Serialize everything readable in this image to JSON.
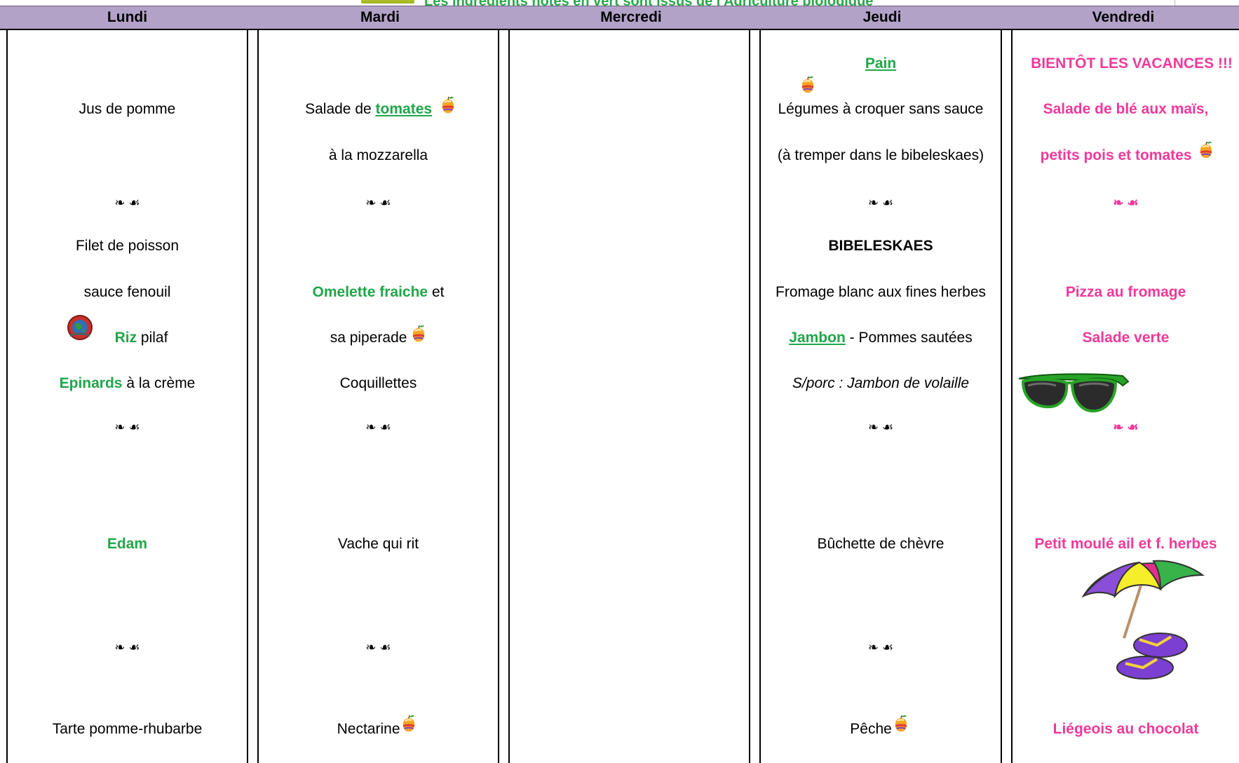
{
  "banner": {
    "text": "Les ingrédients notés en vert sont issus de l'Agriculture biologique"
  },
  "days": [
    "Lundi",
    "Mardi",
    "Mercredi",
    "Jeudi",
    "Vendredi"
  ],
  "separator": "❧ ☙",
  "lundi": {
    "entree": "Jus de pomme",
    "plat_1": "Filet de poisson",
    "plat_2": "sauce fenouil",
    "riz_bio": "Riz",
    "riz_rest": "pilaf",
    "epinards_bio": "Epinards",
    "epinards_rest": "à la crème",
    "fromage": "Edam",
    "dessert": "Tarte pomme-rhubarbe"
  },
  "mardi": {
    "entree_1a": "Salade de",
    "entree_1b": "tomates",
    "entree_2": "à la mozzarella",
    "plat_1a": "Omelette fraiche",
    "plat_1b": "et",
    "plat_2": "sa piperade",
    "plat_3": "Coquillettes",
    "fromage": "Vache qui rit",
    "dessert": "Nectarine"
  },
  "jeudi": {
    "pain": "Pain",
    "entree_1": "Légumes à croquer sans sauce",
    "entree_2": "(à tremper dans le bibeleskaes)",
    "plat_title": "BIBELESKAES",
    "plat_1": "Fromage blanc aux fines herbes",
    "jambon": "Jambon",
    "plat_2_rest": "- Pommes sautées",
    "plat_3": "S/porc : Jambon de volaille",
    "fromage": "Bûchette de chèvre",
    "dessert": "Pêche"
  },
  "vendredi": {
    "line_1": "BIENTÔT LES VACANCES !!!",
    "line_2": "Salade de blé aux maïs,",
    "line_3": "petits pois et tomates",
    "line_4": "Pizza au fromage",
    "line_5": "Salade verte",
    "line_6": "Petit moulé ail et f. herbes",
    "line_7": "Liégeois au chocolat"
  },
  "colors": {
    "header_bg": "#b3a2c8",
    "bio_green": "#20a64a",
    "friday_pink": "#f0399b"
  },
  "icons": [
    "bio-apple-icon",
    "earth-logo-icon",
    "sunglasses-image",
    "parasol-flipflops-image"
  ]
}
